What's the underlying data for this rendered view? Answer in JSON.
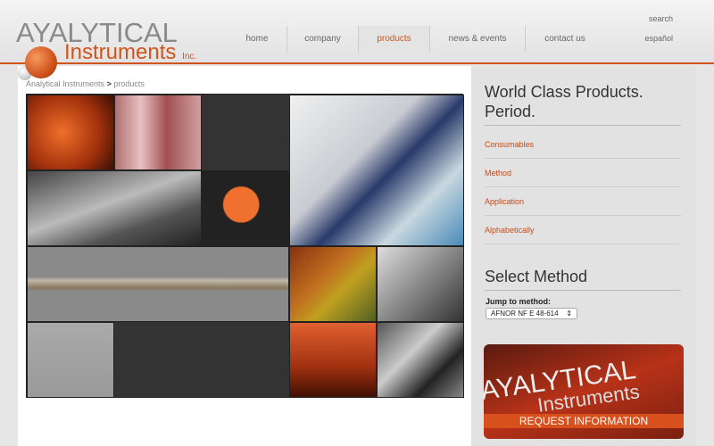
{
  "logo": {
    "line1": "AYALYTICAL",
    "line2": "Instruments",
    "suffix": "Inc."
  },
  "nav": [
    {
      "label": "home"
    },
    {
      "label": "company"
    },
    {
      "label": "products",
      "active": true
    },
    {
      "label": "news & events"
    },
    {
      "label": "contact us"
    }
  ],
  "utility": {
    "search": "search",
    "language": "español"
  },
  "breadcrumb": {
    "root": "Analytical Instruments",
    "sep": ">",
    "current": "products"
  },
  "sidebar": {
    "title": "World Class Products. Period.",
    "links": [
      {
        "label": "Consumables"
      },
      {
        "label": "Method"
      },
      {
        "label": "Application"
      },
      {
        "label": "Alphabetically"
      }
    ],
    "method_title": "Select Method",
    "jump_label": "Jump to method:",
    "jump_value": "AFNOR NF E 48-614",
    "banner": {
      "line1": "AYALYTICAL",
      "line2": "Instruments",
      "cta": "REQUEST INFORMATION"
    }
  },
  "colors": {
    "accent": "#d0541c",
    "background": "#e6e6e6"
  }
}
